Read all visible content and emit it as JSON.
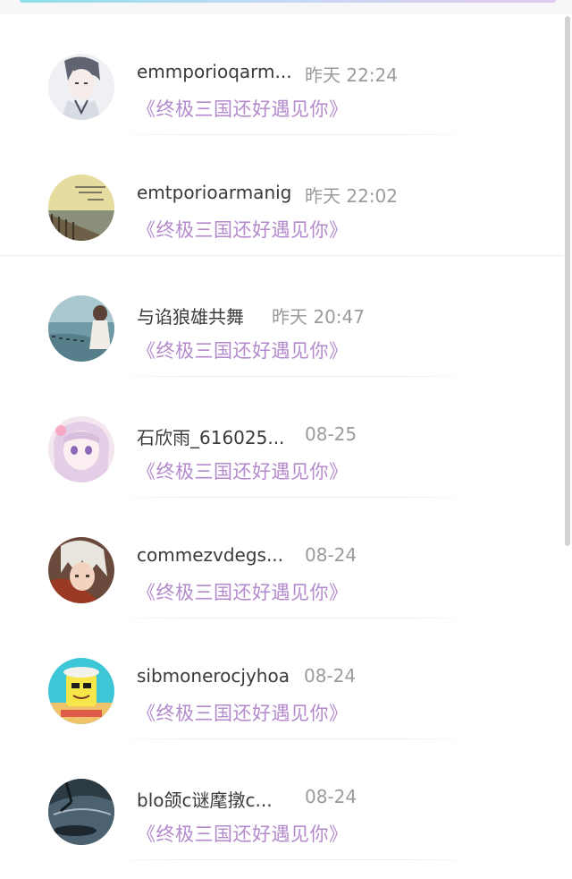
{
  "conversations": [
    {
      "name": "emmporioqarm...",
      "time": "昨天 22:24",
      "message": "《终极三国还好遇见你》",
      "avatar": "avatar-anime-boy"
    },
    {
      "name": "emtporioarmanig",
      "time": "昨天 22:02",
      "message": "《终极三国还好遇见你》",
      "avatar": "avatar-pier-sky"
    },
    {
      "name": "与谄狼雄共舞",
      "time": "昨天 20:47",
      "message": "《终极三国还好遇见你》",
      "avatar": "avatar-seaside-girl"
    },
    {
      "name": "石欣雨_616025...",
      "time": "08-25",
      "message": "《终极三国还好遇见你》",
      "avatar": "avatar-anime-girl"
    },
    {
      "name": "commezvdegs...",
      "time": "08-24",
      "message": "《终极三国还好遇见你》",
      "avatar": "avatar-anime-silver-hair"
    },
    {
      "name": "sibmonerocjyhoa",
      "time": "08-24",
      "message": "《终极三国还好遇见你》",
      "avatar": "avatar-spongebob"
    },
    {
      "name": "blo颌c谜麾撴c...",
      "time": "08-24",
      "message": "《终极三国还好遇见你》",
      "avatar": "avatar-dark-car"
    }
  ],
  "colors": {
    "name": "#3a3a3a",
    "time": "#9b9b9b",
    "message": "#b38acb",
    "divider": "#ececee",
    "scrollbar": "#d3d3d6"
  }
}
